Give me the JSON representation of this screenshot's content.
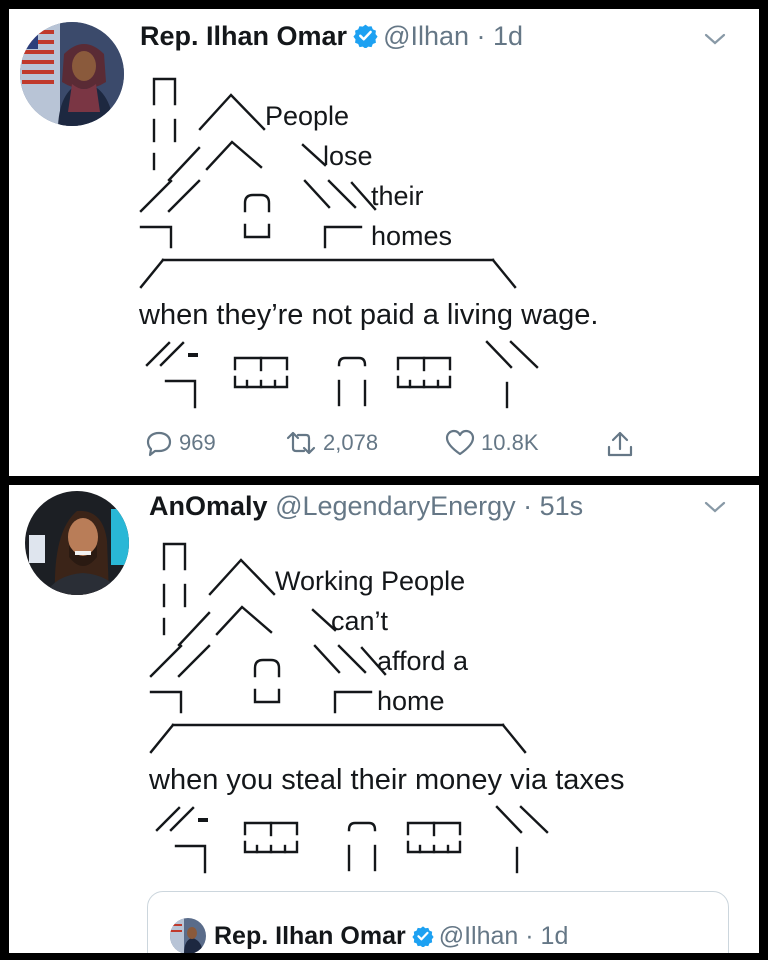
{
  "tweet1": {
    "name": "Rep. Ilhan Omar",
    "handle": "@Ilhan",
    "time": "· 1d",
    "lines": [
      "People",
      "lose",
      "their",
      "homes"
    ],
    "wide_line": "when they’re not paid a living wage.",
    "replies": "969",
    "retweets": "2,078",
    "likes": "10.8K",
    "icons": [
      "verified-badge-icon",
      "chevron-down-icon",
      "reply-icon",
      "retweet-icon",
      "like-heart-icon",
      "share-icon"
    ]
  },
  "tweet2": {
    "name": "AnOmaly",
    "handle": "@LegendaryEnergy",
    "time": "· 51s",
    "lines": [
      "Working People",
      "can’t",
      "afford a",
      "home"
    ],
    "wide_line": "when you steal their money via taxes"
  },
  "quoted": {
    "name": "Rep. Ilhan Omar",
    "handle": "@Ilhan",
    "time": "· 1d"
  },
  "colors": {
    "text": "#14171a",
    "muted": "#657786",
    "verified": "#1da1f2",
    "frame": "#000000"
  }
}
